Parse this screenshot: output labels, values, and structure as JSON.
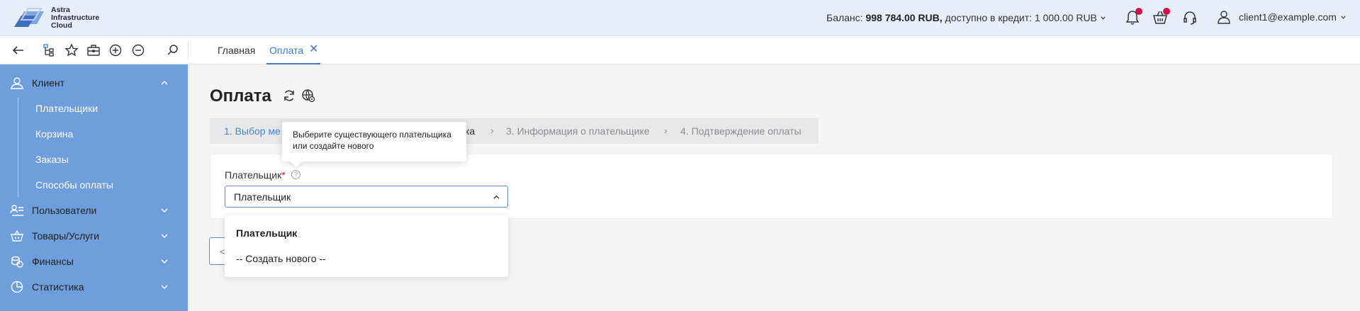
{
  "header": {
    "logo_lines": [
      "Astra",
      "Infrastructure",
      "Cloud"
    ],
    "balance_label": "Баланс:",
    "balance_value": "998 784.00 RUB,",
    "credit_text": "доступно в кредит: 1 000.00 RUB",
    "user_email": "client1@example.com"
  },
  "toolbar": {
    "tabs": [
      {
        "label": "Главная"
      },
      {
        "label": "Оплата",
        "close": "✕"
      }
    ]
  },
  "sidebar": {
    "groups": [
      {
        "label": "Клиент",
        "icon": "user-icon",
        "expanded": true
      },
      {
        "label": "Пользователи",
        "icon": "users-list-icon"
      },
      {
        "label": "Товары/Услуги",
        "icon": "basket-icon"
      },
      {
        "label": "Финансы",
        "icon": "coins-icon"
      },
      {
        "label": "Статистика",
        "icon": "pie-chart-icon"
      }
    ],
    "client_items": [
      "Плательщики",
      "Корзина",
      "Заказы",
      "Способы оплаты"
    ]
  },
  "page": {
    "title": "Оплата",
    "steps": [
      "1. Выбор ме",
      "ка",
      "3. Информация о плательщике",
      "4. Подтверждение оплаты"
    ],
    "step_separator": "›",
    "payer_label": "Плательщик",
    "required_mark": "*",
    "help_mark": "?",
    "select_value": "Плательщик",
    "back_label": "<"
  },
  "dropdown": {
    "options": [
      "Плательщик",
      "-- Создать нового --"
    ]
  },
  "tooltip": {
    "lines": [
      "Выберите существующего плательщика",
      "или создайте нового"
    ]
  },
  "colors": {
    "accent": "#3e7bc6",
    "sidebar": "#6e9fdc",
    "badge": "#d0104c",
    "header_bg": "#e8eef8"
  }
}
